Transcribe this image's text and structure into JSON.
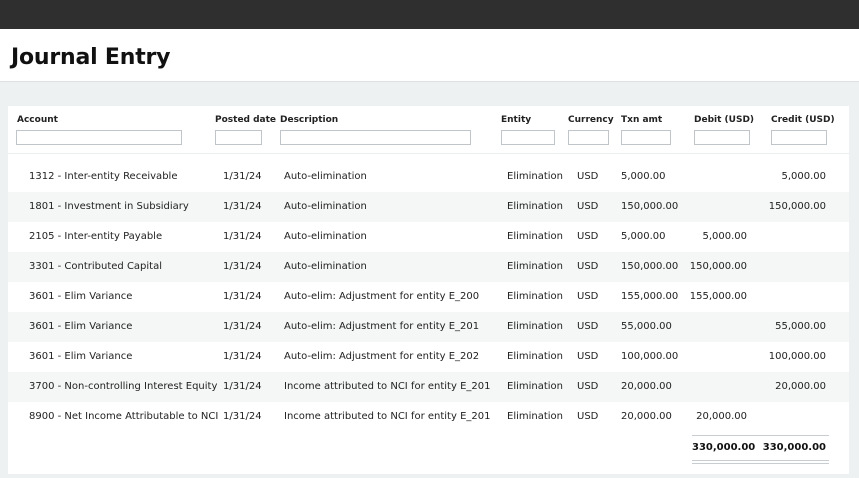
{
  "page": {
    "title": "Journal Entry"
  },
  "columns": [
    {
      "key": "account",
      "label": "Account"
    },
    {
      "key": "posted_date",
      "label": "Posted date"
    },
    {
      "key": "description",
      "label": "Description"
    },
    {
      "key": "entity",
      "label": "Entity"
    },
    {
      "key": "currency",
      "label": "Currency"
    },
    {
      "key": "txn_amt",
      "label": "Txn amt"
    },
    {
      "key": "debit",
      "label": "Debit (USD)"
    },
    {
      "key": "credit",
      "label": "Credit (USD)"
    }
  ],
  "filters": {
    "account": "",
    "posted_date": "",
    "description": "",
    "entity": "",
    "currency": "",
    "txn_amt": "",
    "debit": "",
    "credit": ""
  },
  "rows": [
    {
      "account": "1312 - Inter-entity Receivable",
      "posted_date": "1/31/24",
      "description": "Auto-elimination",
      "entity": "Elimination",
      "currency": "USD",
      "txn_amt": "5,000.00",
      "debit": "",
      "credit": "5,000.00"
    },
    {
      "account": "1801 - Investment in Subsidiary",
      "posted_date": "1/31/24",
      "description": "Auto-elimination",
      "entity": "Elimination",
      "currency": "USD",
      "txn_amt": "150,000.00",
      "debit": "",
      "credit": "150,000.00"
    },
    {
      "account": "2105 - Inter-entity Payable",
      "posted_date": "1/31/24",
      "description": "Auto-elimination",
      "entity": "Elimination",
      "currency": "USD",
      "txn_amt": "5,000.00",
      "debit": "5,000.00",
      "credit": ""
    },
    {
      "account": "3301 - Contributed Capital",
      "posted_date": "1/31/24",
      "description": "Auto-elimination",
      "entity": "Elimination",
      "currency": "USD",
      "txn_amt": "150,000.00",
      "debit": "150,000.00",
      "credit": ""
    },
    {
      "account": "3601 - Elim Variance",
      "posted_date": "1/31/24",
      "description": "Auto-elim: Adjustment for entity E_200",
      "entity": "Elimination",
      "currency": "USD",
      "txn_amt": "155,000.00",
      "debit": "155,000.00",
      "credit": ""
    },
    {
      "account": "3601 - Elim Variance",
      "posted_date": "1/31/24",
      "description": "Auto-elim: Adjustment for entity E_201",
      "entity": "Elimination",
      "currency": "USD",
      "txn_amt": "55,000.00",
      "debit": "",
      "credit": "55,000.00"
    },
    {
      "account": "3601 - Elim Variance",
      "posted_date": "1/31/24",
      "description": "Auto-elim: Adjustment for entity E_202",
      "entity": "Elimination",
      "currency": "USD",
      "txn_amt": "100,000.00",
      "debit": "",
      "credit": "100,000.00"
    },
    {
      "account": "3700 - Non-controlling Interest Equity",
      "posted_date": "1/31/24",
      "description": "Income attributed to NCI for entity E_201",
      "entity": "Elimination",
      "currency": "USD",
      "txn_amt": "20,000.00",
      "debit": "",
      "credit": "20,000.00"
    },
    {
      "account": "8900 - Net Income Attributable to NCI",
      "posted_date": "1/31/24",
      "description": "Income attributed to NCI for entity E_201",
      "entity": "Elimination",
      "currency": "USD",
      "txn_amt": "20,000.00",
      "debit": "20,000.00",
      "credit": ""
    }
  ],
  "totals": {
    "debit": "330,000.00",
    "credit": "330,000.00"
  }
}
